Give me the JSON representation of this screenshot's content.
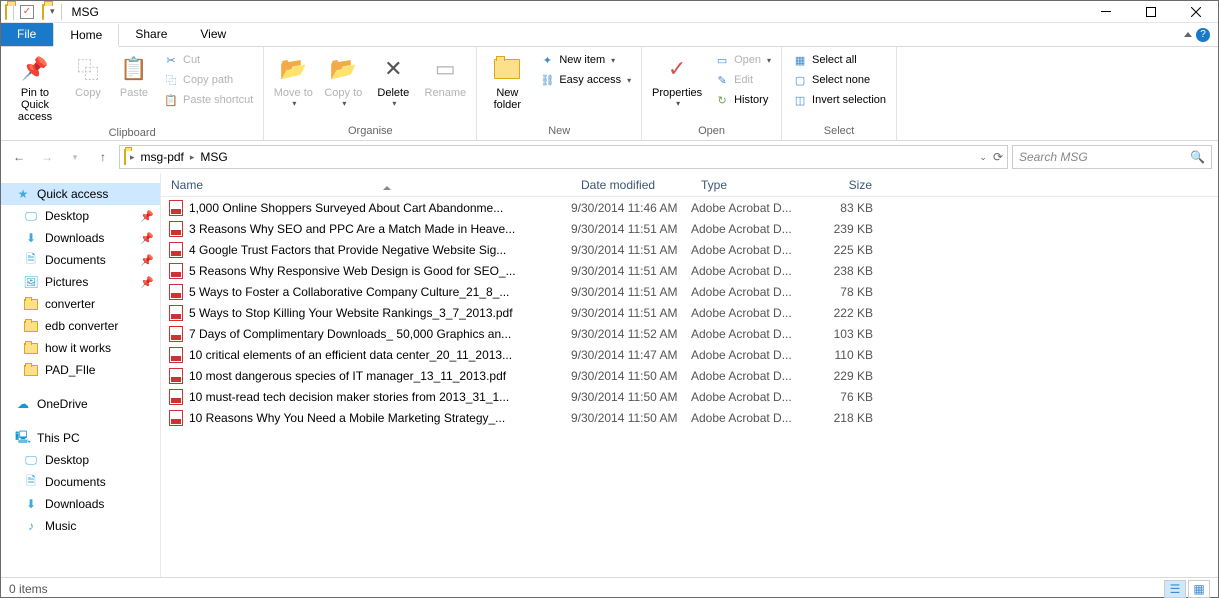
{
  "window": {
    "title": "MSG"
  },
  "tabs": {
    "file": "File",
    "home": "Home",
    "share": "Share",
    "view": "View"
  },
  "ribbon": {
    "clipboard": {
      "label": "Clipboard",
      "pin": "Pin to Quick access",
      "copy": "Copy",
      "paste": "Paste",
      "cut": "Cut",
      "copypath": "Copy path",
      "pasteshortcut": "Paste shortcut"
    },
    "organise": {
      "label": "Organise",
      "moveto": "Move to",
      "copyto": "Copy to",
      "delete": "Delete",
      "rename": "Rename"
    },
    "new": {
      "label": "New",
      "newfolder": "New folder",
      "newitem": "New item",
      "easyaccess": "Easy access"
    },
    "open": {
      "label": "Open",
      "properties": "Properties",
      "open": "Open",
      "edit": "Edit",
      "history": "History"
    },
    "select": {
      "label": "Select",
      "selectall": "Select all",
      "selectnone": "Select none",
      "invert": "Invert selection"
    }
  },
  "breadcrumb": {
    "seg1": "msg-pdf",
    "seg2": "MSG"
  },
  "search": {
    "placeholder": "Search MSG"
  },
  "sidebar": {
    "quickaccess": "Quick access",
    "desktop": "Desktop",
    "downloads": "Downloads",
    "documents": "Documents",
    "pictures": "Pictures",
    "converter": "converter",
    "edbconverter": "edb converter",
    "howitworks": "how it works",
    "padfile": "PAD_FIle",
    "onedrive": "OneDrive",
    "thispc": "This PC",
    "desktop2": "Desktop",
    "documents2": "Documents",
    "downloads2": "Downloads",
    "music": "Music"
  },
  "columns": {
    "name": "Name",
    "date": "Date modified",
    "type": "Type",
    "size": "Size"
  },
  "files": [
    {
      "name": "1,000 Online Shoppers Surveyed About Cart Abandonme...",
      "date": "9/30/2014 11:46 AM",
      "type": "Adobe Acrobat D...",
      "size": "83 KB"
    },
    {
      "name": "3 Reasons Why SEO and PPC Are a Match Made in Heave...",
      "date": "9/30/2014 11:51 AM",
      "type": "Adobe Acrobat D...",
      "size": "239 KB"
    },
    {
      "name": "4 Google Trust Factors that Provide Negative Website Sig...",
      "date": "9/30/2014 11:51 AM",
      "type": "Adobe Acrobat D...",
      "size": "225 KB"
    },
    {
      "name": "5 Reasons Why Responsive Web Design is Good for SEO_...",
      "date": "9/30/2014 11:51 AM",
      "type": "Adobe Acrobat D...",
      "size": "238 KB"
    },
    {
      "name": "5 Ways to Foster a Collaborative Company Culture_21_8_...",
      "date": "9/30/2014 11:51 AM",
      "type": "Adobe Acrobat D...",
      "size": "78 KB"
    },
    {
      "name": "5 Ways to Stop Killing Your Website Rankings_3_7_2013.pdf",
      "date": "9/30/2014 11:51 AM",
      "type": "Adobe Acrobat D...",
      "size": "222 KB"
    },
    {
      "name": "7 Days of Complimentary Downloads_ 50,000 Graphics an...",
      "date": "9/30/2014 11:52 AM",
      "type": "Adobe Acrobat D...",
      "size": "103 KB"
    },
    {
      "name": "10 critical elements of an efficient data center_20_11_2013...",
      "date": "9/30/2014 11:47 AM",
      "type": "Adobe Acrobat D...",
      "size": "110 KB"
    },
    {
      "name": "10 most dangerous species of IT manager_13_11_2013.pdf",
      "date": "9/30/2014 11:50 AM",
      "type": "Adobe Acrobat D...",
      "size": "229 KB"
    },
    {
      "name": "10 must-read tech decision maker stories from 2013_31_1...",
      "date": "9/30/2014 11:50 AM",
      "type": "Adobe Acrobat D...",
      "size": "76 KB"
    },
    {
      "name": "10 Reasons Why You Need a Mobile Marketing Strategy_...",
      "date": "9/30/2014 11:50 AM",
      "type": "Adobe Acrobat D...",
      "size": "218 KB"
    }
  ],
  "status": {
    "items": "0 items"
  }
}
